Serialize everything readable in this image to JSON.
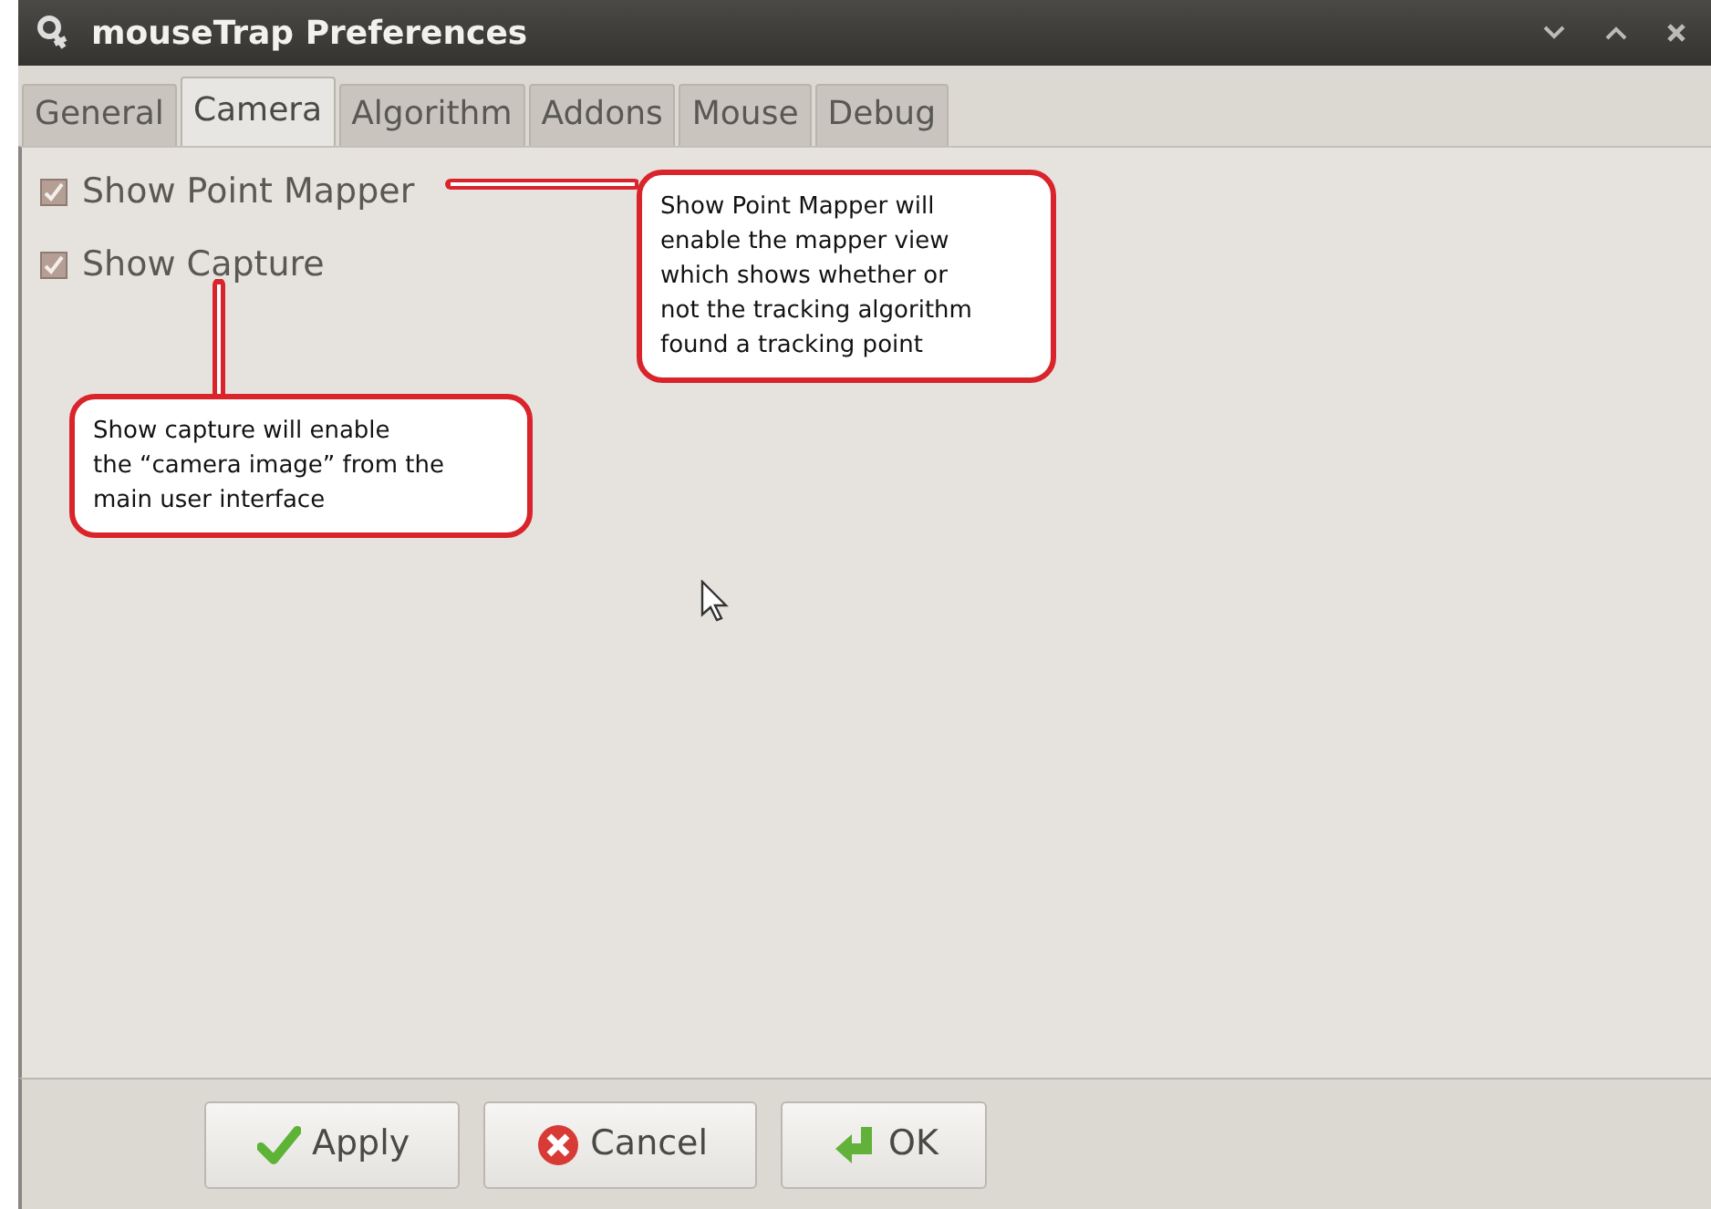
{
  "window": {
    "title": "mouseTrap Preferences"
  },
  "tabs": [
    {
      "label": "General",
      "selected": false
    },
    {
      "label": "Camera",
      "selected": true
    },
    {
      "label": "Algorithm",
      "selected": false
    },
    {
      "label": "Addons",
      "selected": false
    },
    {
      "label": "Mouse",
      "selected": false
    },
    {
      "label": "Debug",
      "selected": false
    }
  ],
  "options": [
    {
      "label": "Show Point Mapper",
      "checked": true
    },
    {
      "label": "Show Capture",
      "checked": true
    }
  ],
  "callouts": [
    {
      "text": "Show Point Mapper will\nenable the mapper view\nwhich shows whether or\nnot the tracking algorithm\nfound a tracking point",
      "kind": "side"
    },
    {
      "text": "Show capture will enable\nthe “camera image” from the\nmain user interface",
      "kind": "below"
    }
  ],
  "buttons": [
    {
      "label": "Apply",
      "kind": "apply"
    },
    {
      "label": "Cancel",
      "kind": "cancel"
    },
    {
      "label": "OK",
      "kind": "ok"
    }
  ]
}
